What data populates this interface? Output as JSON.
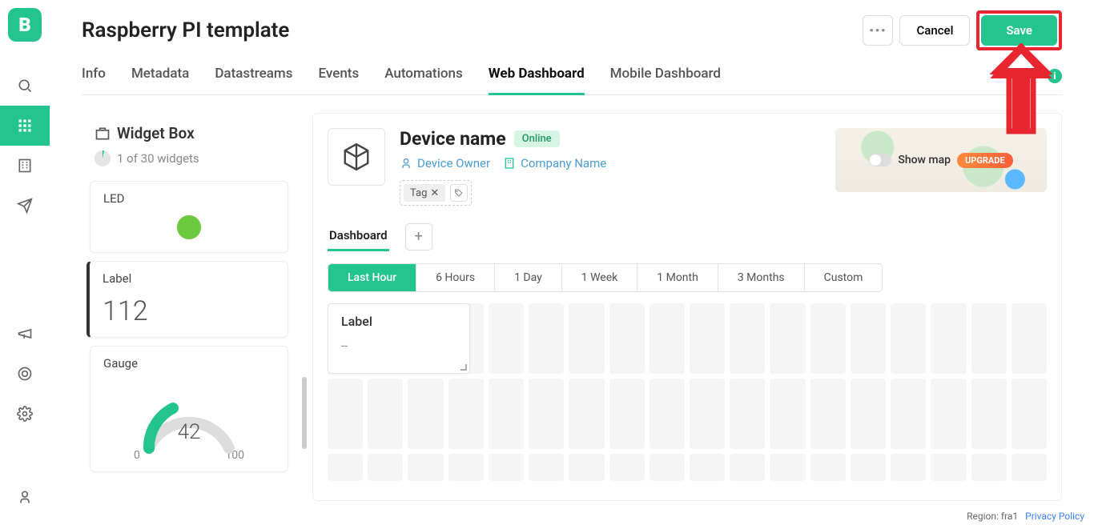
{
  "header": {
    "title": "Raspberry PI template",
    "cancel": "Cancel",
    "save": "Save"
  },
  "tabs": [
    "Info",
    "Metadata",
    "Datastreams",
    "Events",
    "Automations",
    "Web Dashboard",
    "Mobile Dashboard"
  ],
  "active_tab": "Web Dashboard",
  "widget_box": {
    "title": "Widget Box",
    "count": "1 of 30 widgets",
    "widgets": [
      {
        "name": "LED"
      },
      {
        "name": "Label",
        "value": "112"
      },
      {
        "name": "Gauge",
        "value": "42",
        "min": "0",
        "max": "100"
      }
    ]
  },
  "device": {
    "name": "Device name",
    "status": "Online",
    "owner": "Device Owner",
    "company": "Company Name",
    "tag": "Tag"
  },
  "map": {
    "label": "Show map",
    "upgrade": "UPGRADE"
  },
  "sub_tabs": {
    "dashboard": "Dashboard"
  },
  "time_tabs": [
    "Last Hour",
    "6 Hours",
    "1 Day",
    "1 Week",
    "1 Month",
    "3 Months",
    "Custom"
  ],
  "placed": {
    "title": "Label",
    "value": "--"
  },
  "footer": {
    "region": "Region: fra1",
    "privacy": "Privacy Policy"
  }
}
